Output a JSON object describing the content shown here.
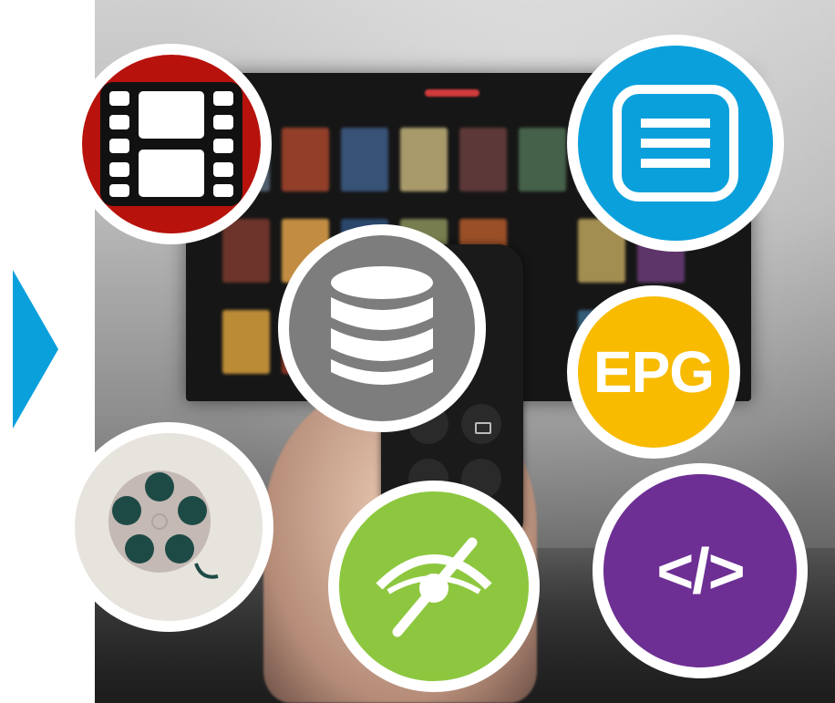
{
  "arrow": {
    "color": "#0aa0dc",
    "icon": "triangle-right"
  },
  "badges": {
    "film": {
      "icon": "film-strip-icon",
      "color": "#b8120c"
    },
    "list": {
      "icon": "list-icon",
      "color": "#0aa0dc"
    },
    "database": {
      "icon": "database-icon",
      "color": "#7d7d7d"
    },
    "epg": {
      "icon": "epg-icon",
      "label": "EPG",
      "color": "#f8bb00"
    },
    "reel": {
      "icon": "film-reel-icon",
      "color": "#e7e3dd"
    },
    "eye": {
      "icon": "hidden-eye-icon",
      "color": "#8dc73f"
    },
    "code": {
      "icon": "code-icon",
      "label": "</>",
      "color": "#6d2f94"
    }
  }
}
